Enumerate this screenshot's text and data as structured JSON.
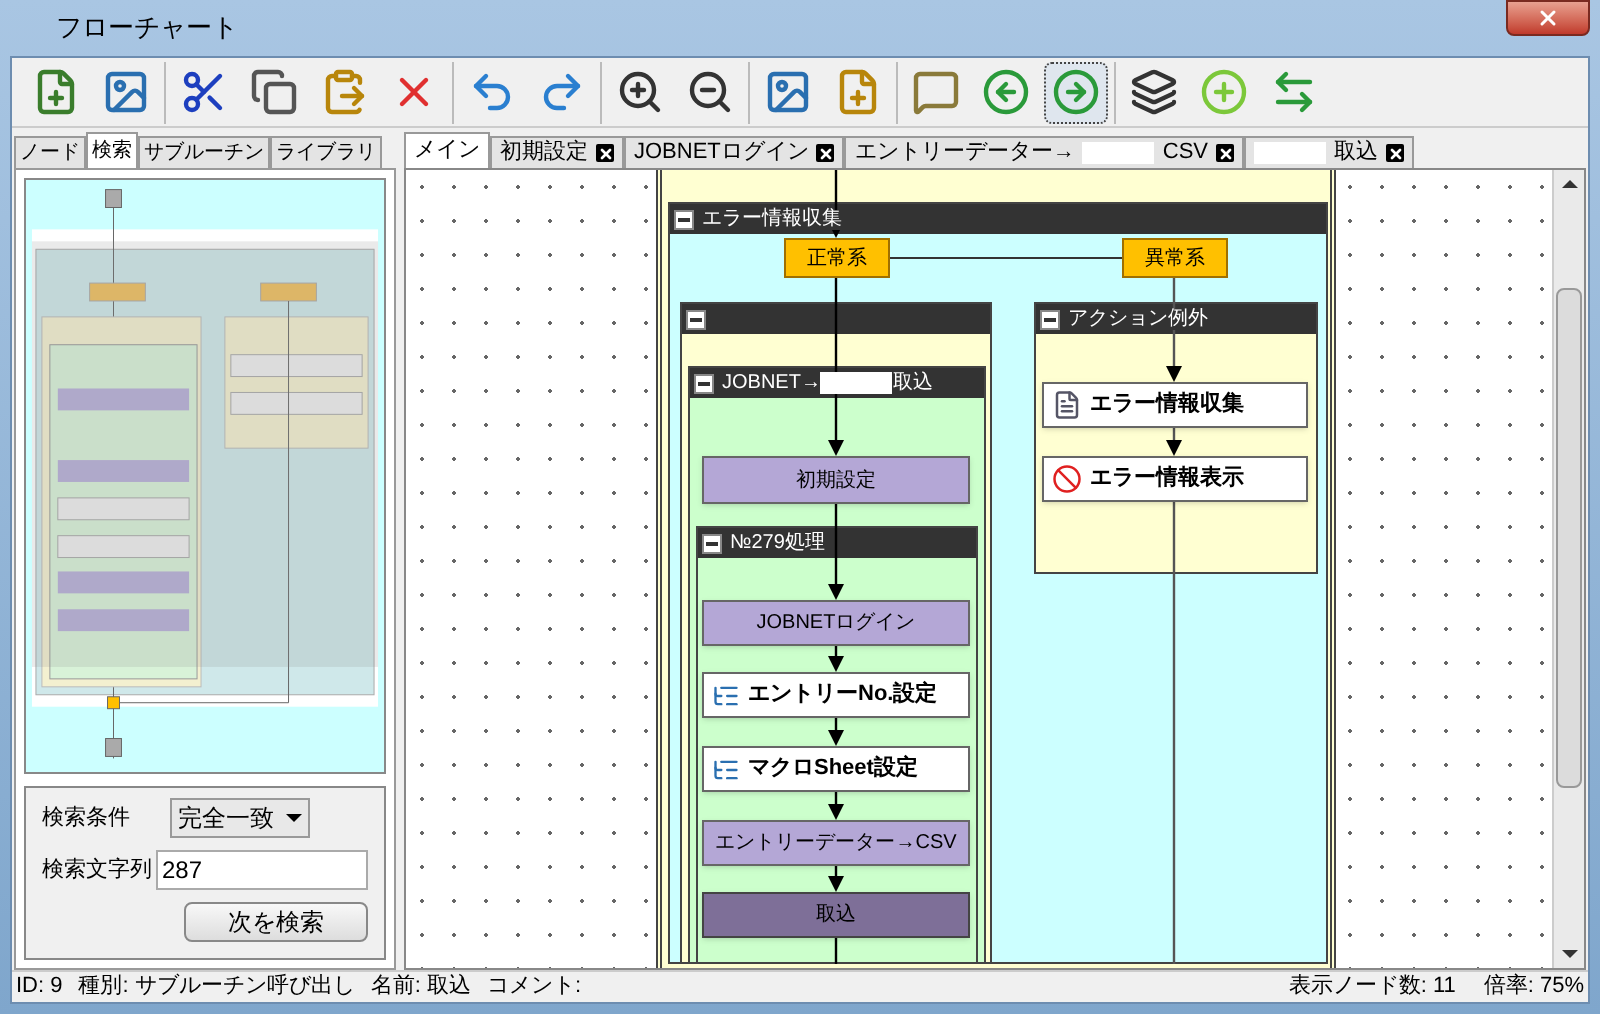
{
  "window": {
    "title": "フローチャート"
  },
  "toolbar": [
    [
      {
        "selected": false
      },
      {
        "selected": false
      }
    ],
    [
      {
        "selected": false
      },
      {
        "selected": false
      },
      {
        "selected": false
      },
      {
        "selected": false
      }
    ],
    [
      {
        "selected": false
      },
      {
        "selected": false
      }
    ],
    [
      {
        "selected": false
      },
      {
        "selected": false
      }
    ],
    [
      {
        "selected": false
      },
      {
        "selected": false
      }
    ],
    [
      {
        "selected": false
      },
      {
        "selected": false
      },
      {
        "selected": true
      }
    ],
    [
      {
        "selected": false
      },
      {
        "selected": false
      },
      {
        "selected": false
      }
    ]
  ],
  "left_tabs": [
    {
      "label": "ノード",
      "selected": false
    },
    {
      "label": "検索",
      "selected": true
    },
    {
      "label": "サブルーチン",
      "selected": false
    },
    {
      "label": "ライブラリ",
      "selected": false
    }
  ],
  "search_panel": {
    "condition_label": "検索条件",
    "condition_value": "完全一致",
    "text_label": "検索文字列",
    "text_value": "287",
    "button": "次を検索"
  },
  "doc_tabs": [
    {
      "selected": true,
      "closable": false,
      "segments": [
        {
          "kind": "text",
          "text": "メイン"
        }
      ]
    },
    {
      "selected": false,
      "closable": true,
      "segments": [
        {
          "kind": "text",
          "text": "初期設定"
        }
      ]
    },
    {
      "selected": false,
      "closable": true,
      "segments": [
        {
          "kind": "text",
          "text": "JOBNETログイン"
        }
      ]
    },
    {
      "selected": false,
      "closable": true,
      "segments": [
        {
          "kind": "text",
          "text": "エントリーデーター→"
        },
        {
          "kind": "redacted"
        },
        {
          "kind": "text",
          "text": "CSV"
        }
      ]
    },
    {
      "selected": false,
      "closable": true,
      "segments": [
        {
          "kind": "redacted"
        },
        {
          "kind": "text",
          "text": "取込"
        }
      ]
    }
  ],
  "flowchart": {
    "groups": [
      {
        "kind": "exception",
        "segments": [
          {
            "kind": "text",
            "text": "エラー情報収集"
          }
        ]
      },
      {
        "kind": "branch"
      },
      {
        "kind": "branch",
        "segments": [
          {
            "kind": "text",
            "text": "アクション例外"
          }
        ]
      },
      {
        "kind": "subroutine",
        "segments": [
          {
            "kind": "text",
            "text": "JOBNET→"
          },
          {
            "kind": "redacted"
          },
          {
            "kind": "text",
            "text": "取込"
          }
        ]
      },
      {
        "kind": "subroutine",
        "segments": [
          {
            "kind": "text",
            "text": "№279処理"
          }
        ]
      }
    ],
    "nodes": [
      {
        "kind": "branch",
        "label": "正常系",
        "selected": false
      },
      {
        "kind": "branch",
        "label": "異常系",
        "selected": false
      },
      {
        "kind": "action",
        "label": "エラー情報収集",
        "selected": false
      },
      {
        "kind": "subroutine",
        "label": "初期設定",
        "selected": false
      },
      {
        "kind": "action",
        "label": "エラー情報表示",
        "selected": false
      },
      {
        "kind": "subroutine",
        "label": "JOBNETログイン",
        "selected": false
      },
      {
        "kind": "action",
        "label": "エントリーNo.設定",
        "selected": false
      },
      {
        "kind": "action",
        "label": "マクロSheet設定",
        "selected": false
      },
      {
        "kind": "subroutine",
        "label": "エントリーデーター→CSV",
        "selected": false
      },
      {
        "kind": "subroutine",
        "label": "取込",
        "selected": true
      }
    ]
  },
  "status_bar": {
    "left": [
      "ID: 9",
      "種別: サブルーチン呼び出し",
      "名前: 取込",
      "コメント:"
    ],
    "right": [
      "表示ノード数: 11",
      "倍率: 75%"
    ]
  }
}
